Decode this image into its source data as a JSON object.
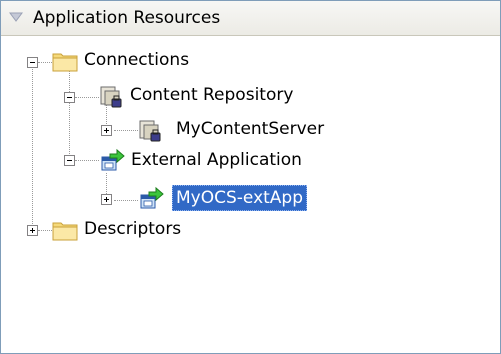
{
  "panel": {
    "title": "Application Resources",
    "collapse_icon": "triangle-down-icon"
  },
  "tree": {
    "connections": {
      "label": "Connections",
      "expanded": true,
      "icon": "folder-icon",
      "children": {
        "content_repository": {
          "label": "Content Repository",
          "expanded": true,
          "icon": "content-repository-icon",
          "child": {
            "label": "MyContentServer",
            "expanded": false,
            "icon": "content-repository-icon"
          }
        },
        "external_application": {
          "label": "External Application",
          "expanded": true,
          "icon": "external-application-icon",
          "child": {
            "label": "MyOCS-extApp",
            "expanded": false,
            "icon": "external-application-icon",
            "selected": true
          }
        }
      }
    },
    "descriptors": {
      "label": "Descriptors",
      "expanded": false,
      "icon": "folder-icon"
    }
  },
  "colors": {
    "selection": "#3169c6",
    "folder": "#f5d97a",
    "header_bg": "#ecebe5",
    "border": "#7f9db9"
  }
}
